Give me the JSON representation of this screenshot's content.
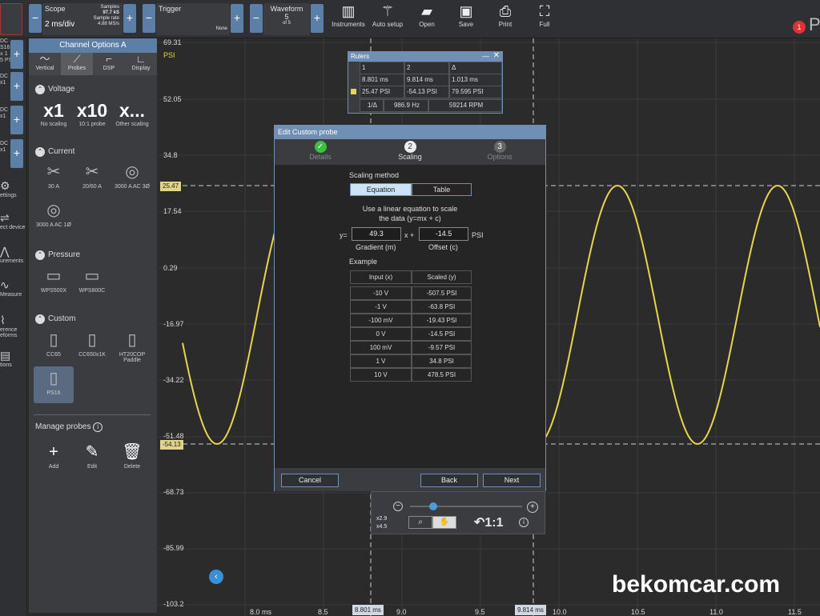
{
  "toolbar": {
    "scope": {
      "title": "Scope",
      "value": "2 ms/div",
      "samples_label": "Samples",
      "samples_value": "97.7 kS",
      "rate_label": "Sample rate",
      "rate_value": "4.88 MS/s"
    },
    "trigger": {
      "title": "Trigger",
      "mode": "None"
    },
    "waveform": {
      "title": "Waveform",
      "value": "5",
      "of": "of 5"
    },
    "buttons": [
      {
        "label": "Instruments",
        "icon": "instruments-icon"
      },
      {
        "label": "Auto setup",
        "icon": "wand-icon"
      },
      {
        "label": "Open",
        "icon": "folder-icon"
      },
      {
        "label": "Save",
        "icon": "floppy-icon"
      },
      {
        "label": "Print",
        "icon": "printer-icon"
      },
      {
        "label": "Full",
        "icon": "fullscreen-icon"
      }
    ],
    "notification_count": "1",
    "logo_partial": "P"
  },
  "left_strip": {
    "channels": [
      {
        "coupling": "DC",
        "probe": "S16",
        "range": "± 1",
        "unit": "5 PS"
      },
      {
        "coupling": "DC",
        "probe": "x1",
        "range": "",
        "unit": ""
      },
      {
        "coupling": "DC",
        "probe": "x1",
        "range": "",
        "unit": ""
      },
      {
        "coupling": "DC",
        "probe": "x1",
        "range": "",
        "unit": ""
      }
    ],
    "items": [
      "ettings",
      "ect device",
      "urements",
      "Measure",
      "erence eforms",
      "tions"
    ]
  },
  "panel": {
    "title": "Channel Options  A",
    "tabs": [
      "Vertical",
      "Probes",
      "DSP",
      "Display"
    ],
    "voltage": {
      "title": "Voltage",
      "options": [
        {
          "big": "x1",
          "label": "No scaling"
        },
        {
          "big": "x10",
          "label": "10:1 probe"
        },
        {
          "big": "x...",
          "label": "Other scaling"
        }
      ]
    },
    "current": {
      "title": "Current",
      "options": [
        "30 A",
        "20/60 A",
        "3000 A AC 3Ø",
        "3000 A AC 1Ø"
      ]
    },
    "pressure": {
      "title": "Pressure",
      "options": [
        "WPS500X",
        "WPS800C"
      ]
    },
    "custom": {
      "title": "Custom",
      "options": [
        "CC65",
        "CC650x1K",
        "HT20COP Paddle",
        "PS16"
      ]
    },
    "manage": {
      "title": "Manage probes",
      "add": "Add",
      "edit": "Edit",
      "delete": "Delete"
    }
  },
  "plot": {
    "y_ticks": [
      "69.31",
      "PSI",
      "52.05",
      "34.8",
      "17.54",
      "0.29",
      "-16.97",
      "-34.22",
      "-51.48",
      "-68.73",
      "-85.99",
      "-103.2"
    ],
    "x_ticks": [
      "8.0 ms",
      "8.5",
      "9.0",
      "9.5",
      "10.0",
      "10.5",
      "11.0",
      "11.5"
    ],
    "ruler_tags": {
      "y1": "25.47",
      "y2": "-54.13",
      "x1": "8.801 ms",
      "x2": "9.814 ms"
    },
    "watermark": "bekomcar.com"
  },
  "rulers": {
    "title": "Rulers",
    "headers": [
      "1",
      "2",
      "Δ"
    ],
    "time_row": [
      "8.801 ms",
      "9.814 ms",
      "1.013 ms"
    ],
    "value_row": [
      "25.47 PSI",
      "-54.13 PSI",
      "79.595 PSI"
    ],
    "freq_row": [
      "1/Δ",
      "986.9 Hz",
      "59214 RPM"
    ]
  },
  "dialog": {
    "title": "Edit Custom probe",
    "steps": [
      {
        "num": "✓",
        "label": "Details"
      },
      {
        "num": "2",
        "label": "Scaling"
      },
      {
        "num": "3",
        "label": "Options"
      }
    ],
    "scaling_method": "Scaling method",
    "seg_equation": "Equation",
    "seg_table": "Table",
    "description_line1": "Use a linear equation to scale",
    "description_line2": "the data (y=mx + c)",
    "y_label": "y=",
    "gradient": "49.3",
    "x_plus": "x +",
    "offset": "-14.5",
    "unit": "PSI",
    "gradient_label": "Gradient (m)",
    "offset_label": "Offset (c)",
    "example_title": "Example",
    "example_headers": [
      "Input (x)",
      "Scaled (y)"
    ],
    "example_rows": [
      [
        "-10 V",
        "-507.5 PSI"
      ],
      [
        "-1 V",
        "-63.8 PSI"
      ],
      [
        "-100 mV",
        "-19.43 PSI"
      ],
      [
        "0 V",
        "-14.5 PSI"
      ],
      [
        "100 mV",
        "-9.57 PSI"
      ],
      [
        "1 V",
        "34.8 PSI"
      ],
      [
        "10 V",
        "478.5 PSI"
      ]
    ],
    "cancel": "Cancel",
    "back": "Back",
    "next": "Next"
  },
  "zoom": {
    "zoom_x": "x2.9",
    "zoom_y": "x4.5",
    "ratio": "1:1"
  },
  "colors": {
    "accent": "#5c7fa8",
    "trace": "#e8d44d",
    "panel": "#3a3c40"
  }
}
